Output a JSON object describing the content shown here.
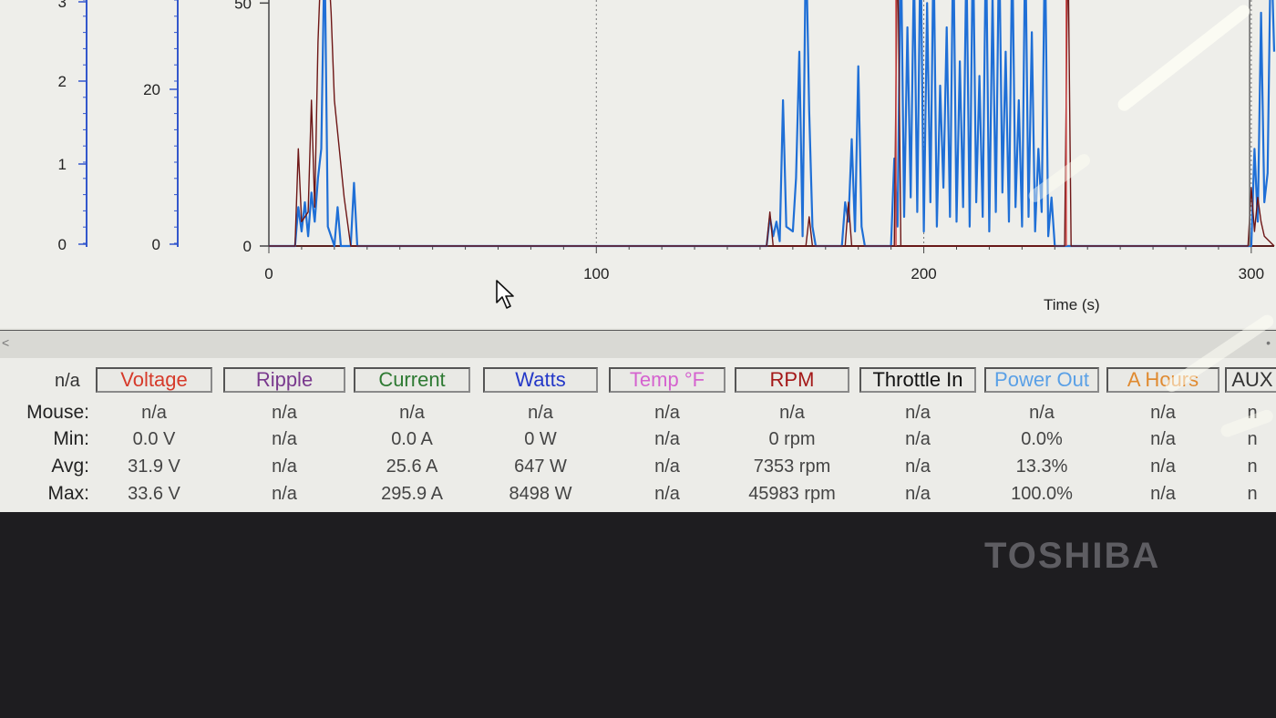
{
  "chart_data": {
    "type": "line",
    "xlabel": "Time (s)",
    "x_ticks": [
      0,
      100,
      200,
      300
    ],
    "xlim": [
      0,
      307
    ],
    "axes": [
      {
        "name": "voltage-axis",
        "ticks": [
          "0",
          "1",
          "2",
          "3"
        ]
      },
      {
        "name": "current-axis",
        "ticks": [
          "0",
          "20"
        ]
      },
      {
        "name": "main-axis",
        "ticks": [
          "0",
          "50"
        ],
        "ylim": [
          0,
          60
        ]
      }
    ],
    "series": [
      {
        "name": "Watts",
        "color": "#1f6fd6",
        "x": [
          0,
          8,
          9,
          10,
          11,
          12,
          13,
          14,
          15,
          16,
          17,
          18,
          20,
          21,
          22,
          25,
          26,
          27,
          152,
          153,
          154,
          155,
          156,
          157,
          158,
          160,
          161,
          162,
          163,
          164,
          165,
          166,
          167,
          175,
          176,
          177,
          178,
          179,
          180,
          181,
          182,
          190,
          191,
          192,
          193,
          194,
          195,
          196,
          197,
          198,
          199,
          200,
          201,
          202,
          203,
          204,
          205,
          206,
          207,
          208,
          209,
          210,
          211,
          212,
          213,
          214,
          215,
          216,
          217,
          218,
          219,
          220,
          221,
          222,
          223,
          224,
          225,
          226,
          227,
          228,
          229,
          230,
          231,
          232,
          233,
          234,
          235,
          236,
          237,
          238,
          239,
          240,
          241,
          298,
          300,
          301,
          302,
          303,
          304,
          305,
          306,
          307
        ],
        "y": [
          0,
          0,
          8,
          3,
          9,
          2,
          11,
          5,
          14,
          20,
          62,
          4,
          0,
          8,
          0,
          0,
          13,
          0,
          0,
          6,
          2,
          5,
          1,
          30,
          4,
          3,
          14,
          40,
          2,
          64,
          28,
          4,
          0,
          0,
          9,
          5,
          22,
          3,
          37,
          4,
          0,
          0,
          18,
          4,
          64,
          6,
          45,
          10,
          58,
          7,
          64,
          3,
          50,
          9,
          62,
          4,
          33,
          12,
          45,
          6,
          64,
          5,
          38,
          8,
          60,
          4,
          64,
          9,
          35,
          6,
          64,
          3,
          52,
          7,
          64,
          11,
          40,
          5,
          62,
          8,
          30,
          4,
          64,
          6,
          44,
          3,
          20,
          7,
          64,
          2,
          10,
          0,
          0,
          0,
          0,
          20,
          5,
          48,
          9,
          15,
          64,
          40
        ]
      },
      {
        "name": "RPM",
        "color": "#6d1616",
        "x": [
          0,
          8,
          9,
          10,
          12,
          13,
          14,
          15,
          16,
          17,
          18,
          19,
          20,
          23,
          25,
          26,
          152,
          153,
          154,
          164,
          165,
          166,
          176,
          177,
          178,
          191,
          192,
          193,
          243,
          244,
          245,
          299,
          300,
          301,
          302,
          303,
          304,
          307
        ],
        "y": [
          0,
          0,
          20,
          5,
          7,
          30,
          8,
          42,
          60,
          64,
          60,
          48,
          30,
          10,
          0,
          0,
          0,
          7,
          0,
          0,
          6,
          0,
          0,
          9,
          0,
          0,
          64,
          0,
          0,
          64,
          0,
          0,
          12,
          3,
          10,
          5,
          2,
          0
        ]
      }
    ]
  },
  "table": {
    "corner": "n/a",
    "headers": [
      {
        "label": "Voltage",
        "color": "#d63a2a"
      },
      {
        "label": "Ripple",
        "color": "#7a3a8e"
      },
      {
        "label": "Current",
        "color": "#2e7a33"
      },
      {
        "label": "Watts",
        "color": "#2438c8"
      },
      {
        "label": "Temp °F",
        "color": "#d563cf"
      },
      {
        "label": "RPM",
        "color": "#a41818"
      },
      {
        "label": "Throttle In",
        "color": "#111111"
      },
      {
        "label": "Power Out",
        "color": "#5aa0e6"
      },
      {
        "label": "A Hours",
        "color": "#e08a30"
      },
      {
        "label": "AUX",
        "color": "#333333"
      }
    ],
    "rows": [
      {
        "label": "Mouse:",
        "values": [
          "n/a",
          "n/a",
          "n/a",
          "n/a",
          "n/a",
          "n/a",
          "n/a",
          "n/a",
          "n/a",
          "n"
        ]
      },
      {
        "label": "Min:",
        "values": [
          "0.0 V",
          "n/a",
          "0.0 A",
          "0 W",
          "n/a",
          "0 rpm",
          "n/a",
          "0.0%",
          "n/a",
          "n"
        ]
      },
      {
        "label": "Avg:",
        "values": [
          "31.9 V",
          "n/a",
          "25.6 A",
          "647 W",
          "n/a",
          "7353 rpm",
          "n/a",
          "13.3%",
          "n/a",
          "n"
        ]
      },
      {
        "label": "Max:",
        "values": [
          "33.6 V",
          "n/a",
          "295.9 A",
          "8498 W",
          "n/a",
          "45983 rpm",
          "n/a",
          "100.0%",
          "n/a",
          "n"
        ]
      }
    ]
  },
  "scrollbar": {
    "left_arrow": "<",
    "right_arrow": "•"
  },
  "brand": "TOSHIBA"
}
